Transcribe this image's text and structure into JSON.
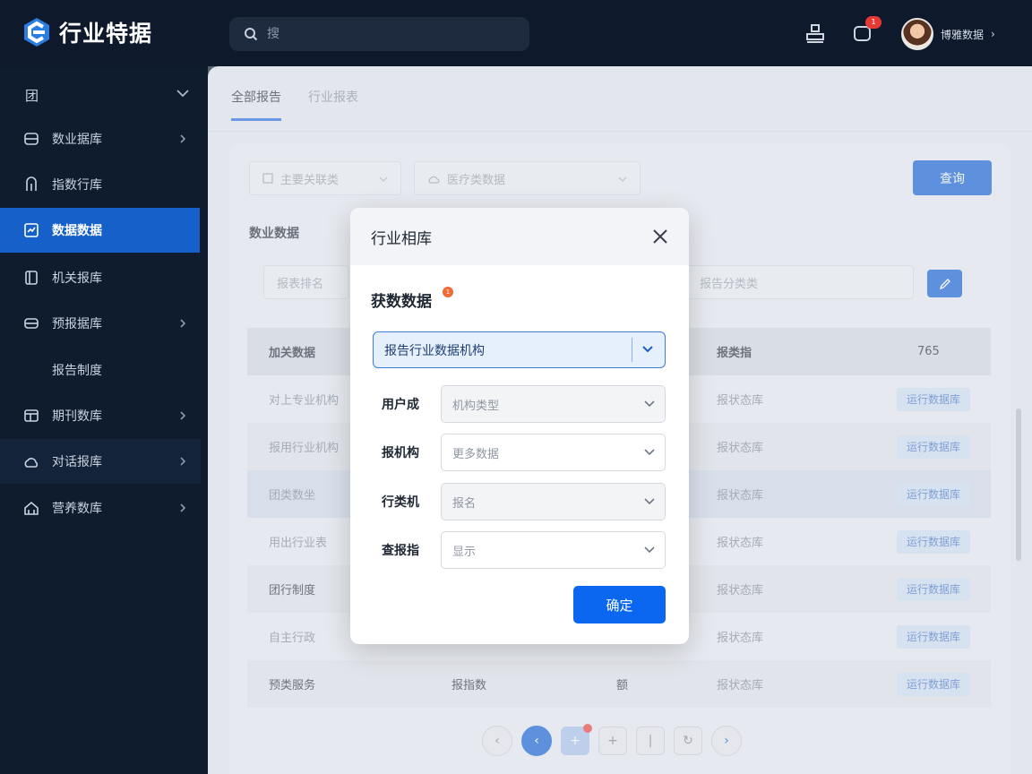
{
  "app": {
    "logo_text": "行业特据"
  },
  "header": {
    "search_placeholder": "搜",
    "notification_count": "1",
    "user_name": "博雅数据",
    "user_arrow": "›"
  },
  "sidebar": {
    "group_label": "团",
    "items": [
      {
        "label": "数业据库",
        "icon": "database-icon",
        "has_arrow": true
      },
      {
        "label": "指数行库",
        "icon": "chart-icon",
        "has_arrow": false
      },
      {
        "label": "数据数据",
        "icon": "data-icon",
        "has_arrow": false,
        "active": true
      },
      {
        "label": "机关报库",
        "icon": "book-icon",
        "has_arrow": false
      },
      {
        "label": "预报据库",
        "icon": "layers-icon",
        "has_arrow": true
      },
      {
        "label": "报告制度",
        "icon": "",
        "has_arrow": false,
        "sub": true
      },
      {
        "label": "期刊数库",
        "icon": "table-icon",
        "has_arrow": true
      },
      {
        "label": "对话报库",
        "icon": "cloud-icon",
        "has_arrow": true
      },
      {
        "label": "营养数库",
        "icon": "home-icon",
        "has_arrow": true
      }
    ]
  },
  "tabs": [
    {
      "label": "全部报告",
      "active": true
    },
    {
      "label": "行业报表",
      "active": false
    }
  ],
  "filters": {
    "filter1": "主要关联类",
    "filter2": "医疗类数据",
    "filter3": "报表排名",
    "filter4": "报告分类类",
    "top_button": "查询",
    "section_title": "数业数据"
  },
  "table": {
    "header": [
      "加关数据",
      "",
      "",
      "报类指",
      "765"
    ],
    "rows": [
      {
        "c1": "对上专业机构",
        "c4": "报状态库",
        "btn": "运行数据库"
      },
      {
        "c1": "报用行业机构",
        "c4": "报状态库",
        "btn": "运行数据库"
      },
      {
        "c1": "团类数坐",
        "c4": "报状态库",
        "btn": "运行数据库"
      },
      {
        "c1": "用出行业表",
        "c4": "报状态库",
        "btn": "运行数据库"
      },
      {
        "c1": "团行制度",
        "c4": "报状态库",
        "btn": "运行数据库"
      },
      {
        "c1": "自主行政",
        "c4": "报状态库",
        "btn": "运行数据库"
      },
      {
        "c1": "预类服务",
        "c2": "报指数",
        "c3": "额",
        "c4": "报状态库",
        "btn": "运行数据库"
      }
    ]
  },
  "pager": [
    "‹",
    "‹",
    "+",
    "+",
    "|",
    "↻",
    "›"
  ],
  "modal": {
    "title": "行业相库",
    "subtitle": "获数数据",
    "subtitle_badge": "1",
    "main_select_value": "报告行业数据机构",
    "fields": [
      {
        "label": "用户成",
        "value": "机构类型"
      },
      {
        "label": "报机构",
        "value": "更多数据"
      },
      {
        "label": "行类机",
        "value": "报名"
      },
      {
        "label": "查报指",
        "value": "显示"
      }
    ],
    "confirm_label": "确定"
  },
  "colors": {
    "accent": "#1664d6",
    "sidebar_bg": "#0f1c2e",
    "active_item": "#1560c9",
    "badge": "#e53935"
  }
}
